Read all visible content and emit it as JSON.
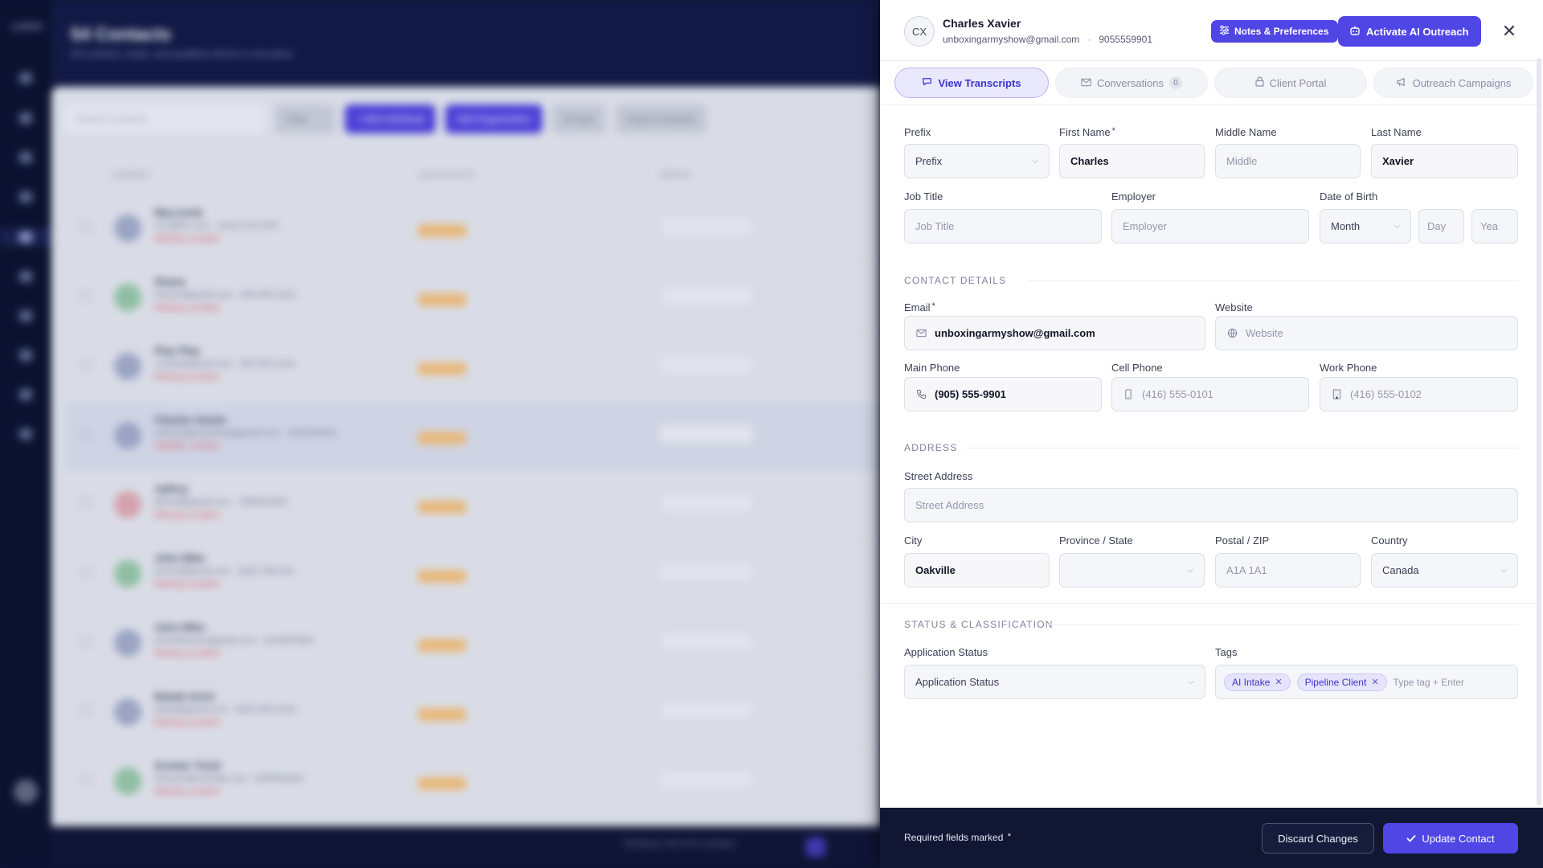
{
  "background": {
    "logo": "LOGO",
    "title": "54 Contacts",
    "subtitle": "All contacts, leads, and qualified clients in one place",
    "toolbar": {
      "search_placeholder": "Search Contacts",
      "filter": "Filter",
      "add_individual": "+ Add Individual",
      "add_organization": "Add Organization",
      "groups": "Groups",
      "import": "Import Contacts"
    },
    "columns": [
      "CONTACT",
      "LAST ACTIVITY",
      "STATUS"
    ],
    "rows": [
      {
        "name": "Maccomb",
        "email": "mzz@fxs.com · (123) 123-1234",
        "note": "Missing Location"
      },
      {
        "name": "Shane",
        "email": "shane2@gmail.com · 905-555-1023",
        "note": "Missing Location"
      },
      {
        "name": "Play Play",
        "email": "contact@gmail.com · 905-555-1023",
        "note": "Missing Location"
      },
      {
        "name": "Charles Xavier",
        "email": "unboxingarmyshow@gmail.com · 9055559901",
        "note": "Oakville, Ontario"
      },
      {
        "name": "Jeffrey",
        "email": "jeff.fed@gmail.com · 7895543345",
        "note": "Missing Location"
      },
      {
        "name": "John Mike",
        "email": "john54@gmail.com · (905) 788-332",
        "note": "Missing Location"
      },
      {
        "name": "John Mike",
        "email": "johnmikeuser@gmail.com · 9234567890",
        "note": "Missing Location"
      },
      {
        "name": "Babak Amiri",
        "email": "babak@gmail.com · (905) 555-1023",
        "note": "Missing Location"
      },
      {
        "name": "Greater Test2",
        "email": "testuser@example.com · 9055550001",
        "note": "Missing Location"
      }
    ],
    "pager_text": "Showing 1-50 of 54 contacts"
  },
  "drawer": {
    "contact": {
      "initials": "CX",
      "name": "Charles Xavier",
      "email": "unboxingarmyshow@gmail.com",
      "separator": "·",
      "phone": "9055559901"
    },
    "header_buttons": {
      "notes": "Notes & Preferences",
      "activate": "Activate AI Outreach",
      "close": "✕"
    },
    "tabs": [
      {
        "label": "View Transcripts",
        "icon": "chat-icon"
      },
      {
        "label": "Conversations",
        "icon": "mail-icon",
        "count": "0"
      },
      {
        "label": "Client Portal",
        "icon": "lock-icon"
      },
      {
        "label": "Outreach Campaigns",
        "icon": "megaphone-icon"
      }
    ],
    "form": {
      "prefix": {
        "label": "Prefix",
        "value": "Prefix"
      },
      "first_name": {
        "label": "First Name",
        "value": "Charles"
      },
      "middle_name": {
        "label": "Middle Name",
        "placeholder": "Middle"
      },
      "last_name": {
        "label": "Last Name",
        "value": "Xavier"
      },
      "job_title": {
        "label": "Job Title",
        "placeholder": "Job Title"
      },
      "employer": {
        "label": "Employer",
        "placeholder": "Employer"
      },
      "dob": {
        "label": "Date of Birth",
        "month": "Month",
        "day": "Day",
        "year": "Yea"
      },
      "contact_section": "CONTACT DETAILS",
      "email": {
        "label": "Email",
        "value": "unboxingarmyshow@gmail.com"
      },
      "website": {
        "label": "Website",
        "placeholder": "Website"
      },
      "main_phone": {
        "label": "Main Phone",
        "value": "(905) 555-9901"
      },
      "cell_phone": {
        "label": "Cell Phone",
        "placeholder": "(416) 555-0101"
      },
      "work_phone": {
        "label": "Work Phone",
        "placeholder": "(416) 555-0102"
      },
      "address_section": "ADDRESS",
      "street": {
        "label": "Street Address",
        "placeholder": "Street Address"
      },
      "city": {
        "label": "City",
        "value": "Oakville"
      },
      "province": {
        "label": "Province / State",
        "value": ""
      },
      "postal": {
        "label": "Postal / ZIP",
        "placeholder": "A1A 1A1"
      },
      "country": {
        "label": "Country",
        "value": "Canada"
      },
      "status_section": "STATUS & CLASSIFICATION",
      "application_status": {
        "label": "Application Status",
        "value": "Application Status"
      },
      "tags": {
        "label": "Tags",
        "items": [
          "AI Intake",
          "Pipeline Client"
        ],
        "placeholder": "Type tag + Enter"
      }
    },
    "required_asterisk": "*",
    "footer": {
      "note": "Required fields marked",
      "discard": "Discard Changes",
      "update": "Update Contact"
    }
  }
}
